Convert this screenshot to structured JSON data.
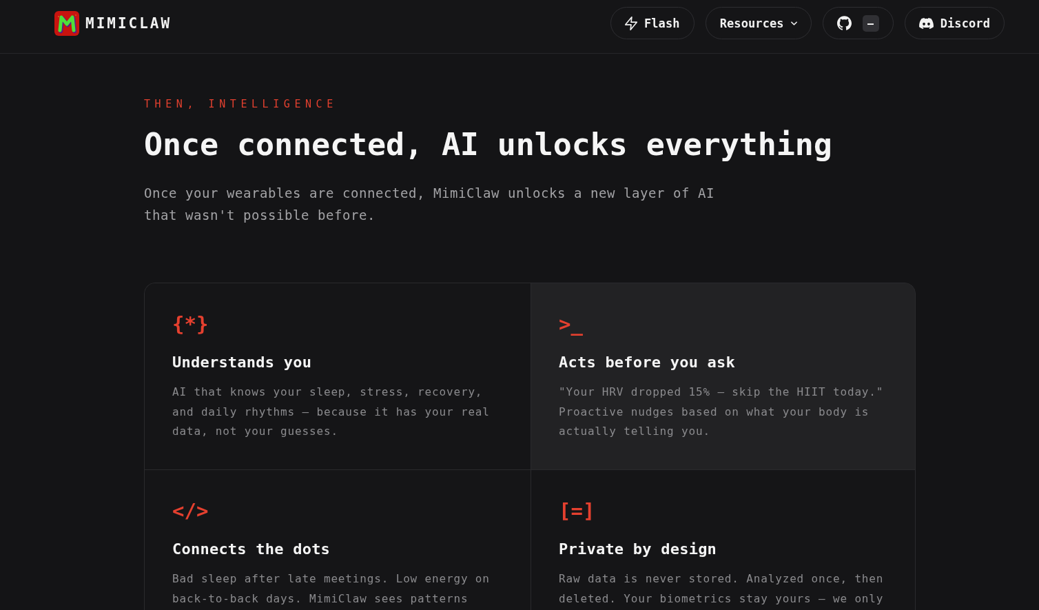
{
  "header": {
    "logo": {
      "text": "MIMICLAW"
    },
    "nav": [
      {
        "kind": "button",
        "label": "Flash"
      },
      {
        "kind": "dropdown",
        "label": "Resources"
      },
      {
        "kind": "badge_button",
        "badge": "–"
      },
      {
        "kind": "button",
        "label": "Discord"
      }
    ]
  },
  "hero": {
    "eyebrow": "THEN, INTELLIGENCE",
    "title": "Once connected, AI unlocks everything",
    "subtitle": "Once your wearables are connected, MimiClaw unlocks a new layer of AI that wasn't possible before."
  },
  "features": [
    {
      "glyph": "{*}",
      "title": "Understands you",
      "description": "AI that knows your sleep, stress, recovery, and daily rhythms — because it has your real data, not your guesses.",
      "highlighted": false
    },
    {
      "glyph": ">_",
      "title": "Acts before you ask",
      "description": "\"Your HRV dropped 15% — skip the HIIT today.\" Proactive nudges based on what your body is actually telling you.",
      "highlighted": true
    },
    {
      "glyph": "</>",
      "title": "Connects the dots",
      "description": "Bad sleep after late meetings. Low energy on back-to-back days. MimiClaw sees patterns",
      "highlighted": false
    },
    {
      "glyph": "[=]",
      "title": "Private by design",
      "description": "Raw data is never stored. Analyzed once, then deleted. Your biometrics stay yours — we only",
      "highlighted": false
    }
  ]
}
